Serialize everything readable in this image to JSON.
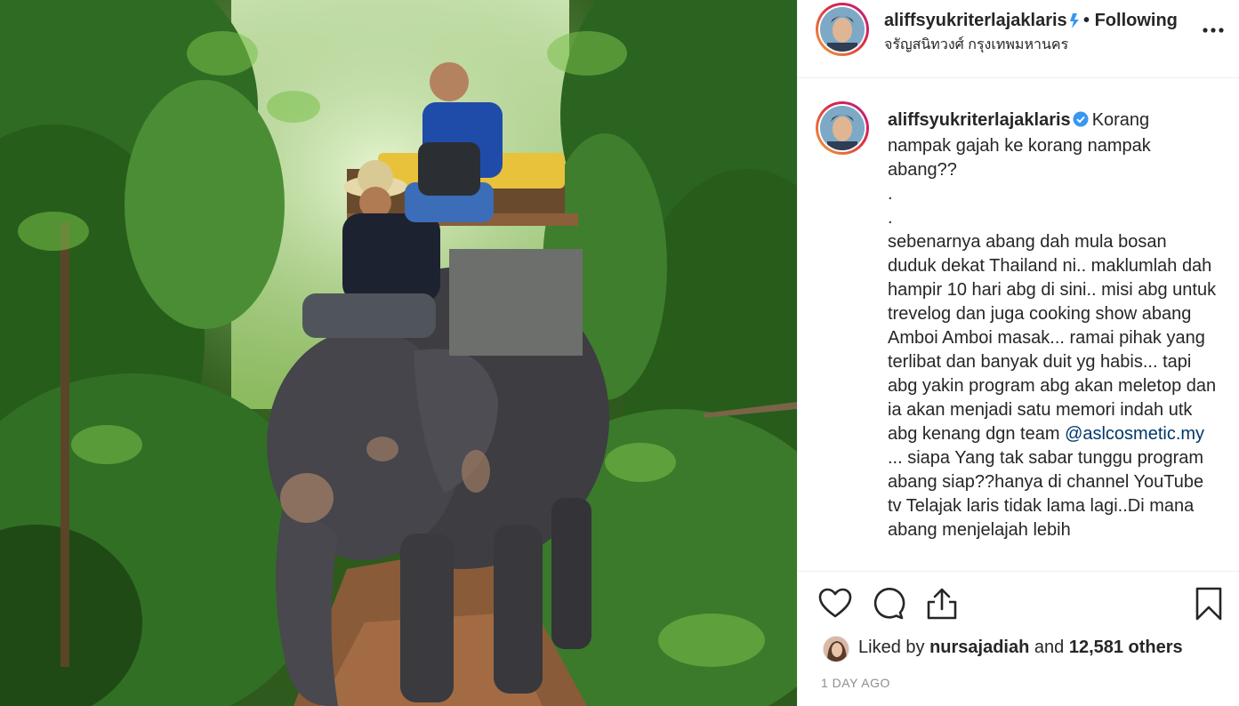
{
  "post": {
    "username": "aliffsyukriterlajaklaris",
    "follow_separator": "•",
    "follow_status": "Following",
    "location": "จรัญสนิทวงศ์ กรุงเทพมหานคร",
    "more_icon": "more-options-icon",
    "verified_color": "#3897f0"
  },
  "caption": {
    "username": "aliffsyukriterlajaklaris",
    "lines": [
      "Korang nampak gajah ke korang nampak abang??",
      ".",
      ".",
      "sebenarnya abang dah mula bosan duduk dekat Thailand ni.. maklumlah dah hampir 10 hari abg di sini.. misi abg untuk trevelog dan juga cooking show abang Amboi Amboi masak... ramai pihak yang terlibat dan banyak duit yg habis... tapi abg yakin program abg akan meletop dan ia akan menjadi satu memori indah utk abg kenang dgn team"
    ],
    "mention": "@aslcosmetic.my",
    "after_mention": " ... siapa Yang tak sabar tunggu program abang siap??hanya di channel YouTube tv Telajak laris tidak lama lagi..Di mana abang menjelajah lebih"
  },
  "actions": {
    "icons": [
      "heart-icon",
      "comment-icon",
      "share-icon",
      "bookmark-icon"
    ]
  },
  "likes": {
    "prefix": "Liked by",
    "user": "nursajadiah",
    "connector": "and",
    "count_text": "12,581 others"
  },
  "timestamp": "1 DAY AGO"
}
